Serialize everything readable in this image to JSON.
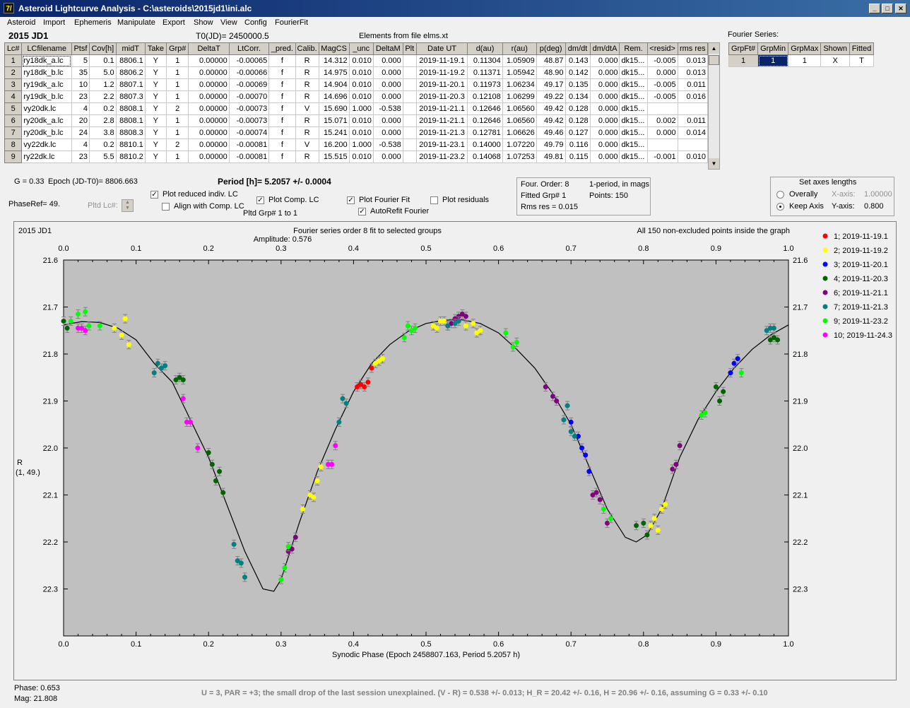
{
  "window": {
    "title": "Asteroid Lightcurve Analysis - C:\\asteroids\\2015jd1\\ini.alc",
    "icon": "app-icon"
  },
  "menu": [
    "Asteroid",
    "Import",
    "Ephemeris",
    "Manipulate",
    "Export",
    "Show",
    "View",
    "Config",
    "FourierFit"
  ],
  "header": {
    "object": "2015 JD1",
    "t0": "T0(JD)= 2450000.5",
    "elements": "Elements from file elms.xt"
  },
  "table": {
    "columns": [
      "Lc#",
      "LCfilename",
      "Ptsf",
      "Cov[h]",
      "midT",
      "Take",
      "Grp#",
      "DeltaT",
      "LtCorr.",
      "_pred.",
      "Calib.",
      "MagCS",
      "_unc",
      "DeltaM",
      "Plt",
      "Date UT",
      "d(au)",
      "r(au)",
      "p(deg)",
      "dm/dt",
      "dm/dtA",
      "Rem.",
      "<resid>",
      "rms res"
    ],
    "rows": [
      [
        "1",
        "ry18dk_a.lc",
        "5",
        "0.1",
        "8806.1",
        "Y",
        "1",
        "0.00000",
        "-0.00065",
        "f",
        "R",
        "14.312",
        "0.010",
        "0.000",
        "",
        "2019-11-19.1",
        "0.11304",
        "1.05909",
        "48.87",
        "0.143",
        "0.000",
        "dk15...",
        "-0.005",
        "0.013"
      ],
      [
        "2",
        "ry18dk_b.lc",
        "35",
        "5.0",
        "8806.2",
        "Y",
        "1",
        "0.00000",
        "-0.00066",
        "f",
        "R",
        "14.975",
        "0.010",
        "0.000",
        "",
        "2019-11-19.2",
        "0.11371",
        "1.05942",
        "48.90",
        "0.142",
        "0.000",
        "dk15...",
        "0.000",
        "0.013"
      ],
      [
        "3",
        "ry19dk_a.lc",
        "10",
        "1.2",
        "8807.1",
        "Y",
        "1",
        "0.00000",
        "-0.00069",
        "f",
        "R",
        "14.904",
        "0.010",
        "0.000",
        "",
        "2019-11-20.1",
        "0.11973",
        "1.06234",
        "49.17",
        "0.135",
        "0.000",
        "dk15...",
        "-0.005",
        "0.011"
      ],
      [
        "4",
        "ry19dk_b.lc",
        "23",
        "2.2",
        "8807.3",
        "Y",
        "1",
        "0.00000",
        "-0.00070",
        "f",
        "R",
        "14.696",
        "0.010",
        "0.000",
        "",
        "2019-11-20.3",
        "0.12108",
        "1.06299",
        "49.22",
        "0.134",
        "0.000",
        "dk15...",
        "-0.005",
        "0.016"
      ],
      [
        "5",
        "vy20dk.lc",
        "4",
        "0.2",
        "8808.1",
        "Y",
        "2",
        "0.00000",
        "-0.00073",
        "f",
        "V",
        "15.690",
        "1.000",
        "-0.538",
        "",
        "2019-11-21.1",
        "0.12646",
        "1.06560",
        "49.42",
        "0.128",
        "0.000",
        "dk15...",
        "",
        ""
      ],
      [
        "6",
        "ry20dk_a.lc",
        "20",
        "2.8",
        "8808.1",
        "Y",
        "1",
        "0.00000",
        "-0.00073",
        "f",
        "R",
        "15.071",
        "0.010",
        "0.000",
        "",
        "2019-11-21.1",
        "0.12646",
        "1.06560",
        "49.42",
        "0.128",
        "0.000",
        "dk15...",
        "0.002",
        "0.011"
      ],
      [
        "7",
        "ry20dk_b.lc",
        "24",
        "3.8",
        "8808.3",
        "Y",
        "1",
        "0.00000",
        "-0.00074",
        "f",
        "R",
        "15.241",
        "0.010",
        "0.000",
        "",
        "2019-11-21.3",
        "0.12781",
        "1.06626",
        "49.46",
        "0.127",
        "0.000",
        "dk15...",
        "0.000",
        "0.014"
      ],
      [
        "8",
        "vy22dk.lc",
        "4",
        "0.2",
        "8810.1",
        "Y",
        "2",
        "0.00000",
        "-0.00081",
        "f",
        "V",
        "16.200",
        "1.000",
        "-0.538",
        "",
        "2019-11-23.1",
        "0.14000",
        "1.07220",
        "49.79",
        "0.116",
        "0.000",
        "dk15...",
        "",
        ""
      ],
      [
        "9",
        "ry22dk.lc",
        "23",
        "5.5",
        "8810.2",
        "Y",
        "1",
        "0.00000",
        "-0.00081",
        "f",
        "R",
        "15.515",
        "0.010",
        "0.000",
        "",
        "2019-11-23.2",
        "0.14068",
        "1.07253",
        "49.81",
        "0.115",
        "0.000",
        "dk15...",
        "-0.001",
        "0.010"
      ]
    ]
  },
  "fourier": {
    "title": "Fourier Series:",
    "columns": [
      "GrpFt#",
      "GrpMin",
      "GrpMax",
      "Shown",
      "Fitted"
    ],
    "row": [
      "1",
      "1",
      "1",
      "X",
      "T"
    ]
  },
  "controls": {
    "g": "G = 0.33",
    "epoch": "Epoch (JD-T0)= 8806.663",
    "period": "Period [h]= 5.2057 +/- 0.0004",
    "phaseref": "PhaseRef= 49.",
    "pltd_lc": "Pltd Lc#:",
    "plot_reduced": "Plot reduced indiv. LC",
    "align": "Align with Comp. LC",
    "plot_comp": "Plot Comp. LC",
    "pltd_grp": "Pltd Grp#  1   to   1",
    "plot_fourier": "Plot Fourier Fit",
    "autorefit": "AutoRefit Fourier",
    "plot_resid": "Plot residuals"
  },
  "fitinfo": {
    "order": "Four. Order:  8",
    "period_type": "1-period, in mags",
    "fitted": "Fitted Grp# 1",
    "points": "Points: 150",
    "rms": "Rms res     = 0.015"
  },
  "axes_box": {
    "title": "Set axes lengths",
    "overall": "Overally",
    "keep": "Keep Axis",
    "x_label": "X-axis:",
    "x_val": "1.00000",
    "y_label": "Y-axis:",
    "y_val": "0.800"
  },
  "chart_data": {
    "type": "scatter",
    "title": "Fourier series order 8 fit to selected groups",
    "subtitle": "Amplitude: 0.576",
    "object_label": "2015 JD1",
    "note": "All 150 non-excluded points inside the graph",
    "xlabel": "Synodic Phase (Epoch 2458807.163, Period 5.2057 h)",
    "ylabel": "R",
    "ylabel2": "(1, 49.)",
    "xlim": [
      0,
      1
    ],
    "ylim": [
      22.4,
      21.6
    ],
    "x_ticks": [
      "0.0",
      "0.1",
      "0.2",
      "0.3",
      "0.4",
      "0.5",
      "0.6",
      "0.7",
      "0.8",
      "0.9",
      "1.0"
    ],
    "y_ticks": [
      "21.6",
      "21.7",
      "21.8",
      "21.9",
      "22.0",
      "22.1",
      "22.2",
      "22.3"
    ],
    "series": [
      {
        "name": "1; 2019-11-19.1",
        "color": "#ff0000",
        "points": [
          [
            0.405,
            21.87
          ],
          [
            0.41,
            21.865
          ],
          [
            0.415,
            21.87
          ],
          [
            0.42,
            21.86
          ],
          [
            0.425,
            21.83
          ]
        ]
      },
      {
        "name": "2; 2019-11-19.2",
        "color": "#ffff00",
        "points": [
          [
            0.07,
            21.745
          ],
          [
            0.08,
            21.76
          ],
          [
            0.085,
            21.725
          ],
          [
            0.09,
            21.78
          ],
          [
            0.33,
            22.13
          ],
          [
            0.34,
            22.1
          ],
          [
            0.345,
            22.105
          ],
          [
            0.35,
            22.07
          ],
          [
            0.355,
            22.04
          ],
          [
            0.43,
            21.82
          ],
          [
            0.435,
            21.815
          ],
          [
            0.44,
            21.81
          ],
          [
            0.51,
            21.74
          ],
          [
            0.515,
            21.745
          ],
          [
            0.52,
            21.73
          ],
          [
            0.525,
            21.73
          ],
          [
            0.53,
            21.74
          ],
          [
            0.555,
            21.74
          ],
          [
            0.565,
            21.735
          ],
          [
            0.57,
            21.755
          ],
          [
            0.575,
            21.75
          ],
          [
            0.81,
            22.165
          ],
          [
            0.815,
            22.15
          ],
          [
            0.82,
            22.175
          ],
          [
            0.825,
            22.13
          ],
          [
            0.83,
            22.12
          ]
        ]
      },
      {
        "name": "3; 2019-11-20.1",
        "color": "#0000ff",
        "points": [
          [
            0.7,
            21.945
          ],
          [
            0.71,
            21.975
          ],
          [
            0.715,
            22.0
          ],
          [
            0.72,
            22.015
          ],
          [
            0.725,
            22.05
          ],
          [
            0.92,
            21.84
          ],
          [
            0.925,
            21.82
          ],
          [
            0.93,
            21.81
          ]
        ]
      },
      {
        "name": "4; 2019-11-20.3",
        "color": "#006400",
        "points": [
          [
            0.0,
            21.73
          ],
          [
            0.005,
            21.745
          ],
          [
            0.155,
            21.855
          ],
          [
            0.16,
            21.85
          ],
          [
            0.165,
            21.855
          ],
          [
            0.2,
            22.01
          ],
          [
            0.205,
            22.035
          ],
          [
            0.21,
            22.07
          ],
          [
            0.215,
            22.05
          ],
          [
            0.22,
            22.095
          ],
          [
            0.79,
            22.165
          ],
          [
            0.8,
            22.16
          ],
          [
            0.805,
            22.185
          ],
          [
            0.9,
            21.87
          ],
          [
            0.905,
            21.9
          ],
          [
            0.91,
            21.88
          ],
          [
            0.975,
            21.77
          ],
          [
            0.98,
            21.765
          ],
          [
            0.985,
            21.77
          ]
        ]
      },
      {
        "name": "6; 2019-11-21.1",
        "color": "#800080",
        "points": [
          [
            0.31,
            22.22
          ],
          [
            0.315,
            22.215
          ],
          [
            0.32,
            22.19
          ],
          [
            0.53,
            21.74
          ],
          [
            0.535,
            21.735
          ],
          [
            0.54,
            21.725
          ],
          [
            0.545,
            21.72
          ],
          [
            0.55,
            21.715
          ],
          [
            0.555,
            21.72
          ],
          [
            0.665,
            21.87
          ],
          [
            0.675,
            21.89
          ],
          [
            0.68,
            21.9
          ],
          [
            0.73,
            22.1
          ],
          [
            0.735,
            22.095
          ],
          [
            0.74,
            22.11
          ],
          [
            0.75,
            22.16
          ],
          [
            0.84,
            22.045
          ],
          [
            0.845,
            22.035
          ],
          [
            0.85,
            21.995
          ]
        ]
      },
      {
        "name": "7; 2019-11-21.3",
        "color": "#008080",
        "points": [
          [
            0.125,
            21.84
          ],
          [
            0.13,
            21.82
          ],
          [
            0.135,
            21.83
          ],
          [
            0.14,
            21.825
          ],
          [
            0.235,
            22.205
          ],
          [
            0.24,
            22.24
          ],
          [
            0.245,
            22.245
          ],
          [
            0.25,
            22.275
          ],
          [
            0.38,
            21.945
          ],
          [
            0.385,
            21.895
          ],
          [
            0.39,
            21.905
          ],
          [
            0.53,
            21.74
          ],
          [
            0.54,
            21.735
          ],
          [
            0.545,
            21.73
          ],
          [
            0.69,
            21.94
          ],
          [
            0.695,
            21.91
          ],
          [
            0.7,
            21.965
          ],
          [
            0.705,
            21.975
          ],
          [
            0.97,
            21.75
          ],
          [
            0.975,
            21.745
          ],
          [
            0.98,
            21.745
          ]
        ]
      },
      {
        "name": "9; 2019-11-23.2",
        "color": "#00ff00",
        "points": [
          [
            0.01,
            21.73
          ],
          [
            0.02,
            21.715
          ],
          [
            0.03,
            21.71
          ],
          [
            0.035,
            21.74
          ],
          [
            0.05,
            21.74
          ],
          [
            0.3,
            22.28
          ],
          [
            0.305,
            22.255
          ],
          [
            0.31,
            22.21
          ],
          [
            0.47,
            21.765
          ],
          [
            0.475,
            21.74
          ],
          [
            0.48,
            21.75
          ],
          [
            0.485,
            21.745
          ],
          [
            0.61,
            21.755
          ],
          [
            0.62,
            21.785
          ],
          [
            0.625,
            21.775
          ],
          [
            0.745,
            22.13
          ],
          [
            0.755,
            22.15
          ],
          [
            0.88,
            21.93
          ],
          [
            0.885,
            21.925
          ],
          [
            0.935,
            21.84
          ]
        ]
      },
      {
        "name": "10; 2019-11-24.3",
        "color": "#ff00ff",
        "points": [
          [
            0.02,
            21.745
          ],
          [
            0.025,
            21.745
          ],
          [
            0.03,
            21.75
          ],
          [
            0.165,
            21.895
          ],
          [
            0.17,
            21.945
          ],
          [
            0.175,
            21.945
          ],
          [
            0.185,
            22.0
          ],
          [
            0.365,
            22.035
          ],
          [
            0.37,
            22.035
          ],
          [
            0.375,
            21.995
          ]
        ]
      }
    ],
    "fit_curve": [
      [
        0.0,
        21.738
      ],
      [
        0.025,
        21.731
      ],
      [
        0.05,
        21.733
      ],
      [
        0.075,
        21.745
      ],
      [
        0.1,
        21.77
      ],
      [
        0.125,
        21.82
      ],
      [
        0.15,
        21.86
      ],
      [
        0.175,
        21.94
      ],
      [
        0.2,
        22.02
      ],
      [
        0.225,
        22.12
      ],
      [
        0.25,
        22.22
      ],
      [
        0.275,
        22.3
      ],
      [
        0.29,
        22.305
      ],
      [
        0.3,
        22.28
      ],
      [
        0.325,
        22.16
      ],
      [
        0.35,
        22.05
      ],
      [
        0.375,
        21.96
      ],
      [
        0.4,
        21.88
      ],
      [
        0.425,
        21.82
      ],
      [
        0.45,
        21.78
      ],
      [
        0.475,
        21.752
      ],
      [
        0.5,
        21.735
      ],
      [
        0.525,
        21.728
      ],
      [
        0.55,
        21.727
      ],
      [
        0.575,
        21.735
      ],
      [
        0.6,
        21.755
      ],
      [
        0.625,
        21.79
      ],
      [
        0.65,
        21.83
      ],
      [
        0.675,
        21.885
      ],
      [
        0.7,
        21.95
      ],
      [
        0.725,
        22.04
      ],
      [
        0.75,
        22.13
      ],
      [
        0.775,
        22.19
      ],
      [
        0.79,
        22.2
      ],
      [
        0.805,
        22.185
      ],
      [
        0.825,
        22.13
      ],
      [
        0.85,
        22.02
      ],
      [
        0.875,
        21.94
      ],
      [
        0.9,
        21.88
      ],
      [
        0.925,
        21.83
      ],
      [
        0.95,
        21.79
      ],
      [
        0.975,
        21.76
      ],
      [
        1.0,
        21.738
      ]
    ]
  },
  "status": {
    "phase": "Phase:  0.653",
    "mag": "Mag:    21.808",
    "bottom": "U = 3, PAR = +3; the small drop of the last session unexplained.  (V - R) = 0.538 +/- 0.013; H_R = 20.42 +/- 0.16, H = 20.96 +/- 0.16, assuming G = 0.33 +/- 0.10"
  }
}
